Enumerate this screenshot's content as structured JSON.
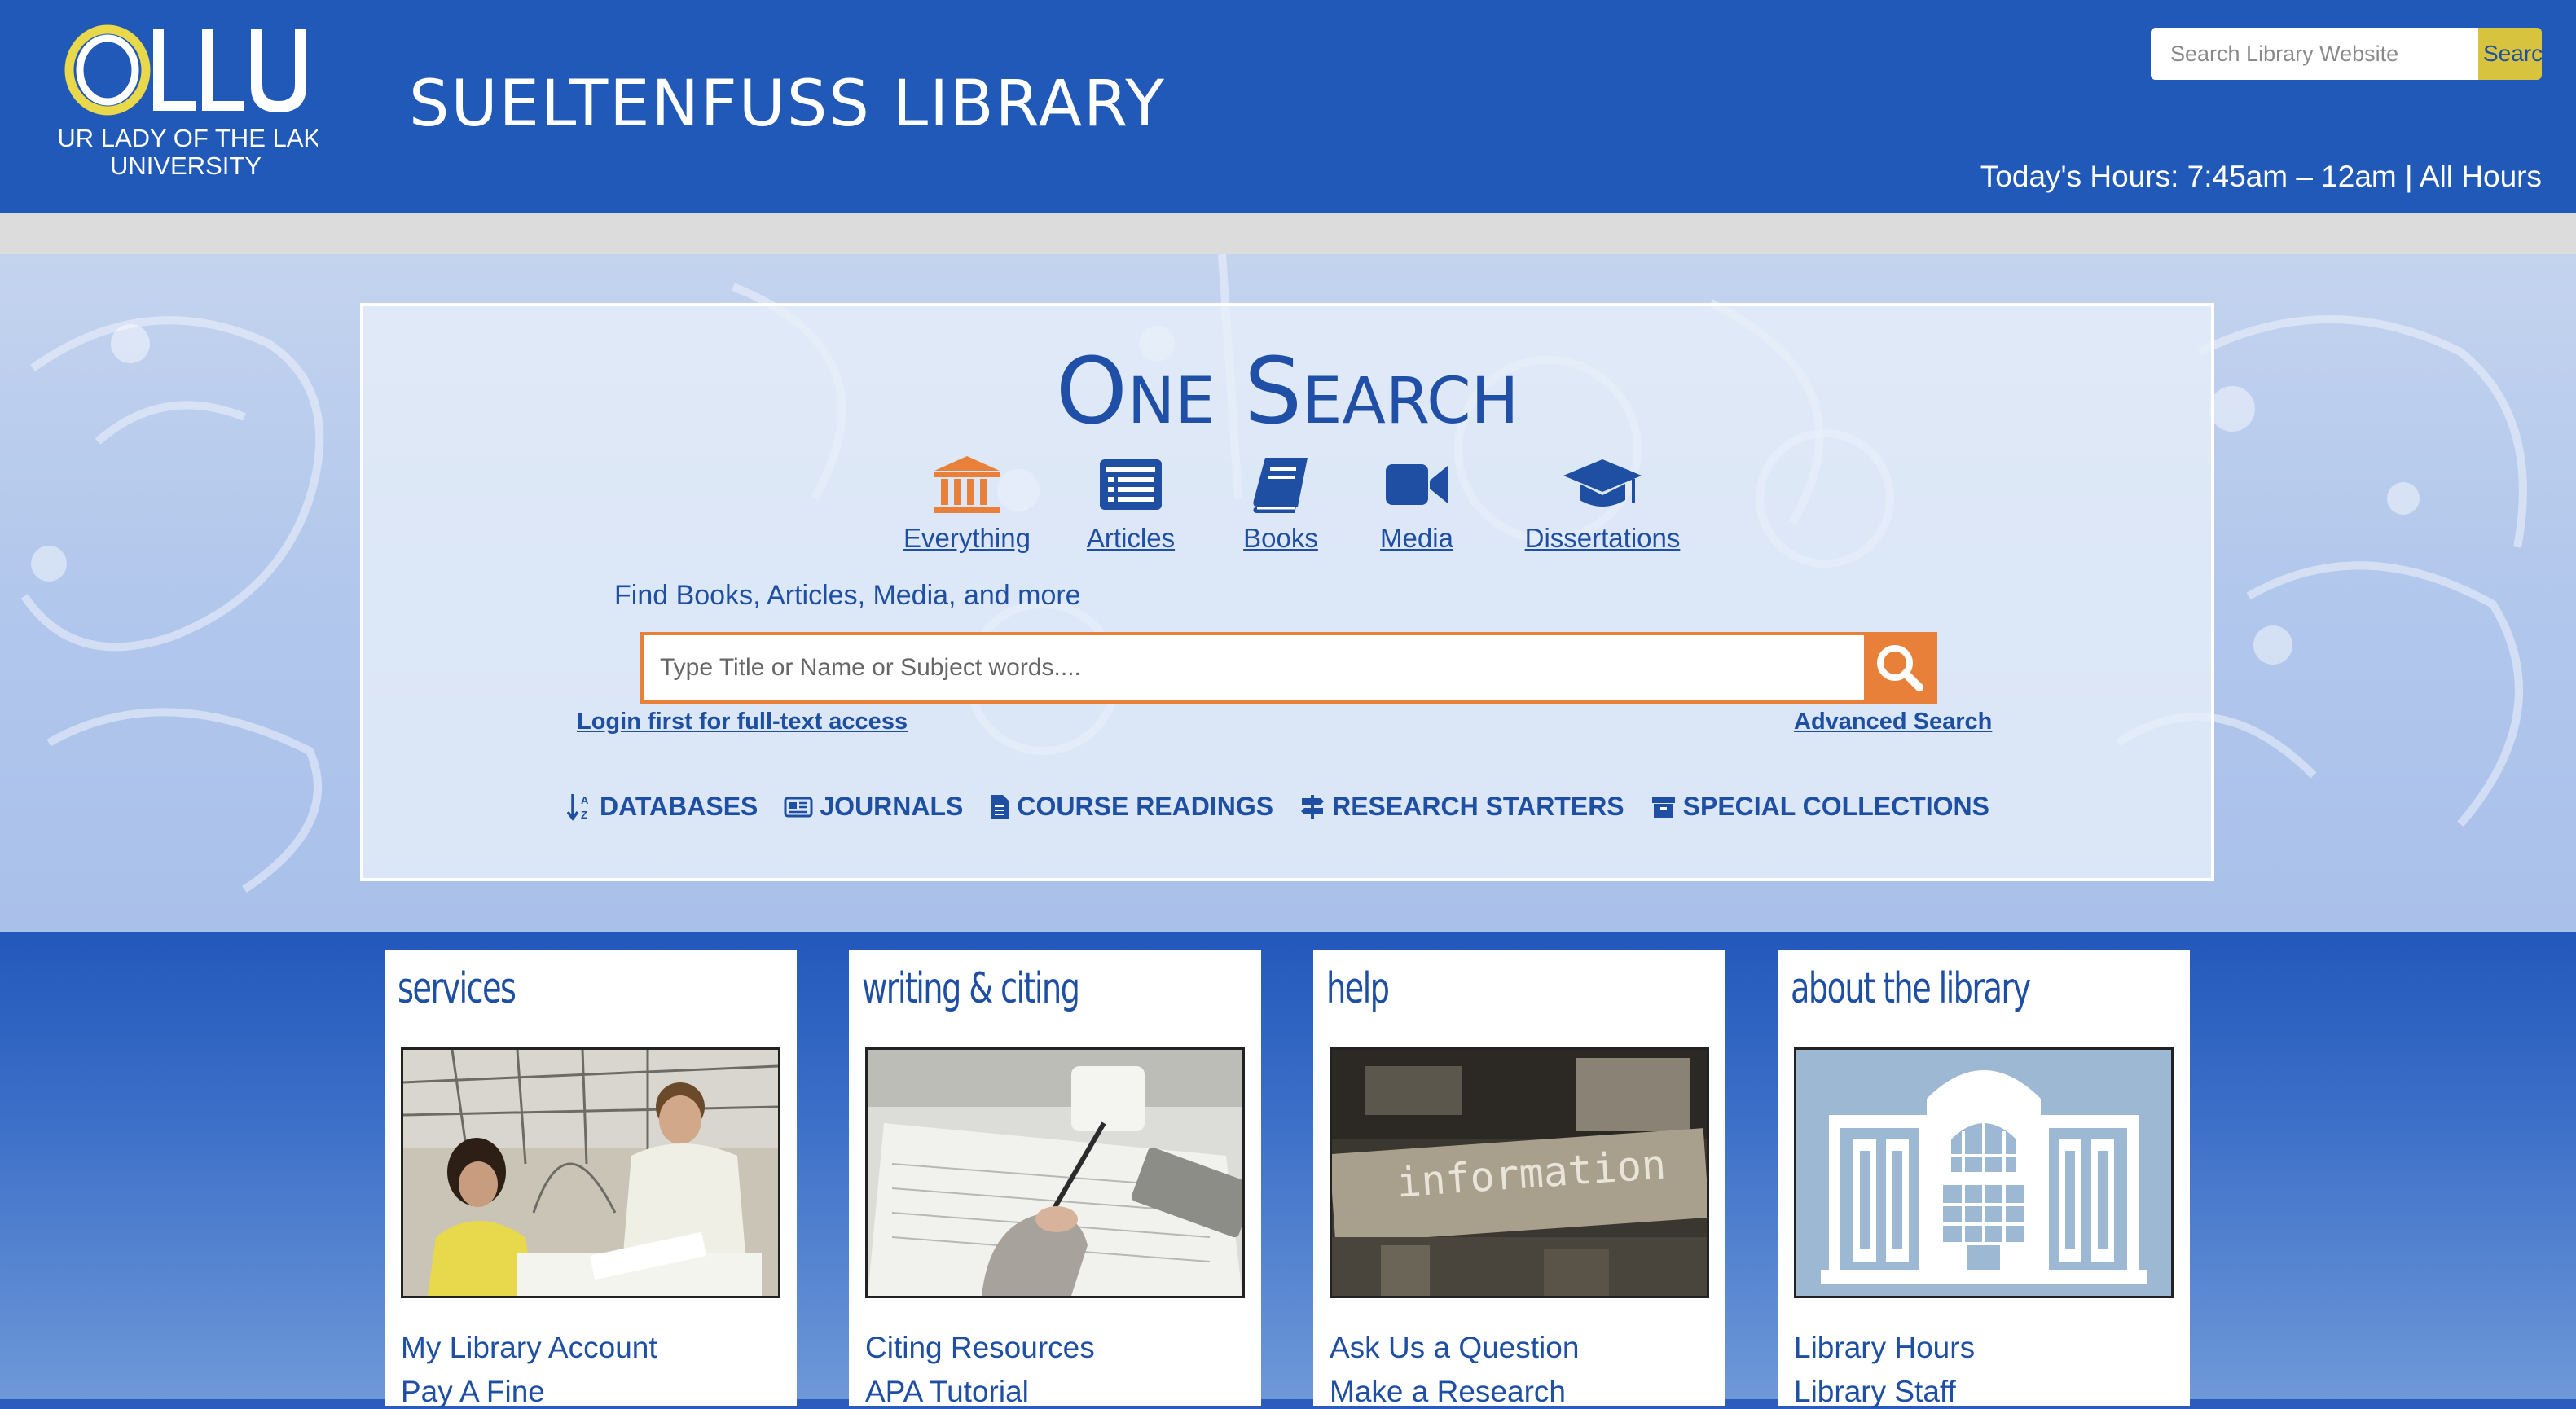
{
  "header": {
    "logo_text": "OLLU",
    "logo_subtext_1": "OUR LADY OF THE LAKE",
    "logo_subtext_2": "UNIVERSITY",
    "site_title": "SUELTENFUSS LIBRARY",
    "search_placeholder": "Search Library Website",
    "search_button": "Search",
    "hours_label": "Today's Hours: 7:45am – 12am",
    "hours_sep": "|",
    "all_hours_link": "All Hours"
  },
  "onesearch": {
    "title": "One Search",
    "categories": [
      {
        "label": "Everything",
        "icon": "institution-icon",
        "active": true
      },
      {
        "label": "Articles",
        "icon": "list-icon"
      },
      {
        "label": "Books",
        "icon": "book-icon"
      },
      {
        "label": "Media",
        "icon": "video-camera-icon"
      },
      {
        "label": "Dissertations",
        "icon": "graduation-cap-icon"
      }
    ],
    "hint": "Find Books, Articles, Media, and more",
    "search_placeholder": "Type Title or Name or Subject words....",
    "login_link": "Login first for full-text access",
    "advanced_link": "Advanced Search",
    "quicklinks": [
      {
        "label": "DATABASES",
        "icon": "sort-alpha-icon"
      },
      {
        "label": "JOURNALS",
        "icon": "newspaper-icon"
      },
      {
        "label": "COURSE READINGS",
        "icon": "document-icon"
      },
      {
        "label": "RESEARCH STARTERS",
        "icon": "signpost-icon"
      },
      {
        "label": "SPECIAL COLLECTIONS",
        "icon": "archive-icon"
      }
    ]
  },
  "cards": [
    {
      "title": "services",
      "links": [
        "My Library Account",
        "Pay A Fine"
      ]
    },
    {
      "title": "writing & citing",
      "links": [
        "Citing Resources",
        "APA Tutorial"
      ]
    },
    {
      "title": "help",
      "links": [
        "Ask Us a Question",
        "Make a Research"
      ],
      "image_text": "information"
    },
    {
      "title": "about the library",
      "links": [
        "Library Hours",
        "Library Staff"
      ]
    }
  ],
  "colors": {
    "header_blue": "#2159b8",
    "link_blue": "#1e4fa3",
    "accent_orange": "#e8803a",
    "search_button_gold": "#d8c33e"
  }
}
